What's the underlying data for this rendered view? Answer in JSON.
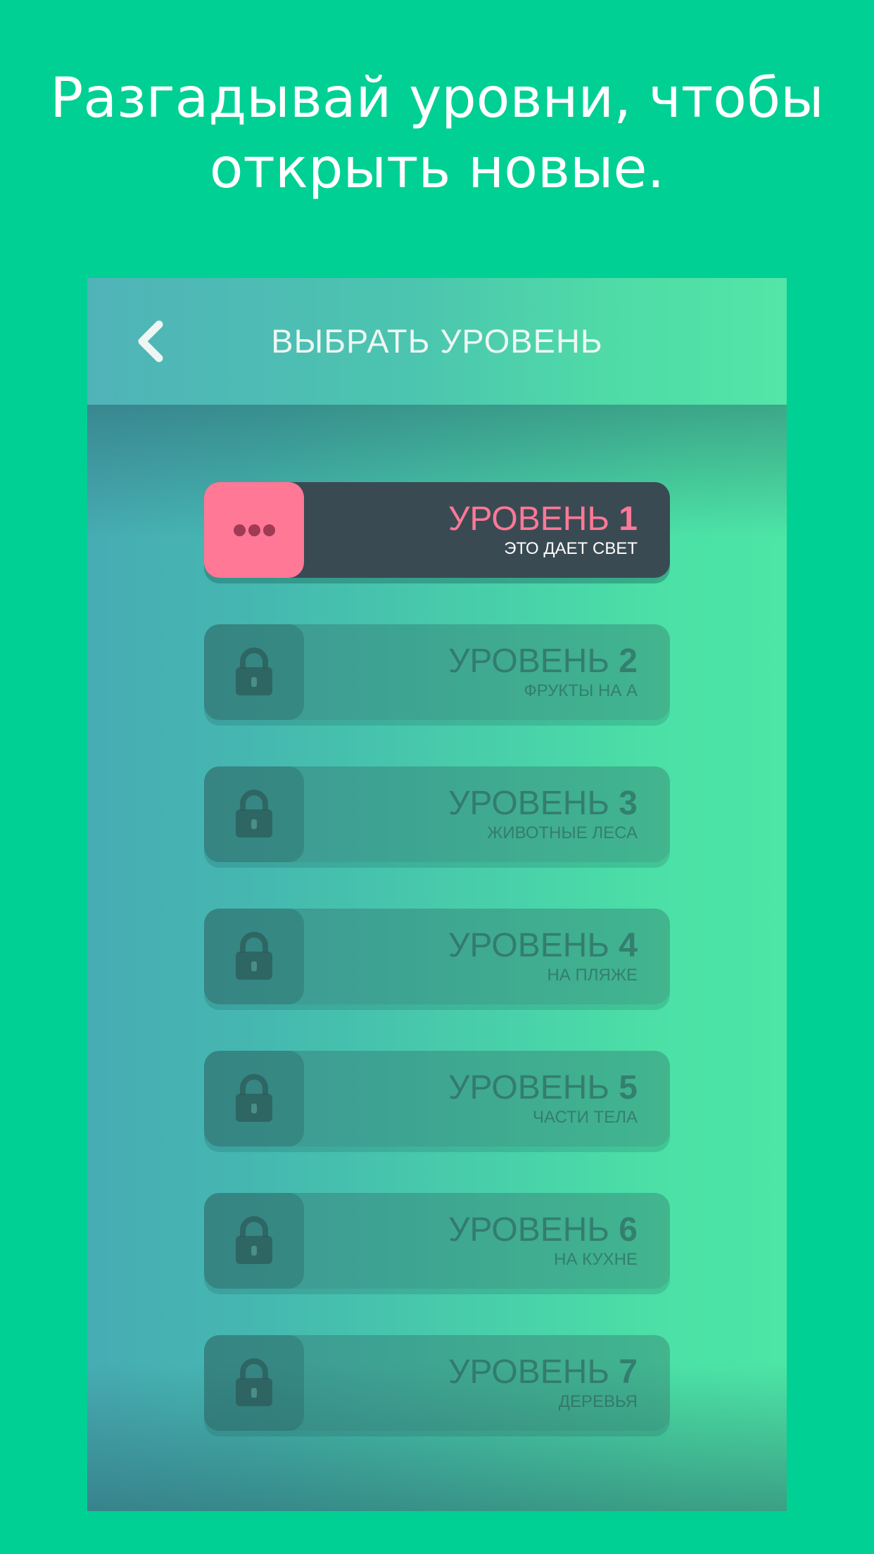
{
  "headline": {
    "line1": "Разгадывай уровни, чтобы",
    "line2": "открыть новые."
  },
  "screen": {
    "title": "ВЫБРАТЬ УРОВЕНЬ",
    "back_icon": "chevron-left-icon"
  },
  "colors": {
    "background": "#00d093",
    "active_card": "#3a4a53",
    "accent_pink": "#ff7896"
  },
  "levels": [
    {
      "label": "УРОВЕНЬ",
      "number": "1",
      "subtitle": "ЭТО ДАЕТ СВЕТ",
      "state": "active",
      "icon": "more-dots-icon"
    },
    {
      "label": "УРОВЕНЬ",
      "number": "2",
      "subtitle": "ФРУКТЫ НА А",
      "state": "locked",
      "icon": "lock-icon"
    },
    {
      "label": "УРОВЕНЬ",
      "number": "3",
      "subtitle": "ЖИВОТНЫЕ ЛЕСА",
      "state": "locked",
      "icon": "lock-icon"
    },
    {
      "label": "УРОВЕНЬ",
      "number": "4",
      "subtitle": "НА ПЛЯЖЕ",
      "state": "locked",
      "icon": "lock-icon"
    },
    {
      "label": "УРОВЕНЬ",
      "number": "5",
      "subtitle": "ЧАСТИ ТЕЛА",
      "state": "locked",
      "icon": "lock-icon"
    },
    {
      "label": "УРОВЕНЬ",
      "number": "6",
      "subtitle": "НА КУХНЕ",
      "state": "locked",
      "icon": "lock-icon"
    },
    {
      "label": "УРОВЕНЬ",
      "number": "7",
      "subtitle": "ДЕРЕВЬЯ",
      "state": "locked",
      "icon": "lock-icon"
    }
  ]
}
